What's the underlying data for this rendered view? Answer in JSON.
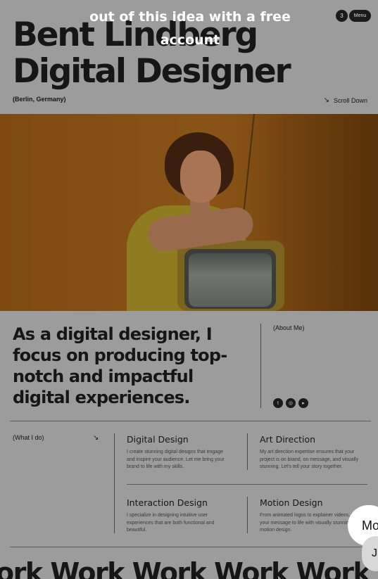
{
  "header": {
    "name_line1": "Bent Lindberg",
    "name_line2": "Digital Designer",
    "location": "(Berlin, Germany)",
    "scroll_label": "Scroll Down",
    "scroll_icon": "arrow-down-right-icon",
    "menu_count": "3",
    "menu_label": "Menu"
  },
  "promo": {
    "text": "out of this idea with a free account"
  },
  "intro": {
    "headline": "As a digital designer, I focus on producing top-notch and impactful digital experiences.",
    "about_label": "(About Me)",
    "socials": [
      "twitter-icon",
      "instagram-icon",
      "youtube-icon"
    ]
  },
  "services": {
    "section_label": "(What I do)",
    "items": [
      {
        "title": "Digital Design",
        "description": "I create stunning digital designs that engage and inspire your audience. Let me bring your brand to life with my skills."
      },
      {
        "title": "Art Direction",
        "description": "My art direction expertise ensures that your project is on brand, on message, and visually stunning. Let's tell your story together."
      },
      {
        "title": "Interaction Design",
        "description": "I specialize in designing intuitive user experiences that are both functional and beautiful."
      },
      {
        "title": "Motion Design",
        "description": "From animated logos to explainer videos, I bring your message to life with visually stunning motion design."
      }
    ]
  },
  "marquee": {
    "text": "ork Work Work Work Work"
  },
  "chat": {
    "bubble_text": "Mo",
    "small_text": "J"
  },
  "colors": {
    "overlay_background": "#9c9c9c",
    "ink": "#161616",
    "photo_wall": "#8a5416"
  }
}
